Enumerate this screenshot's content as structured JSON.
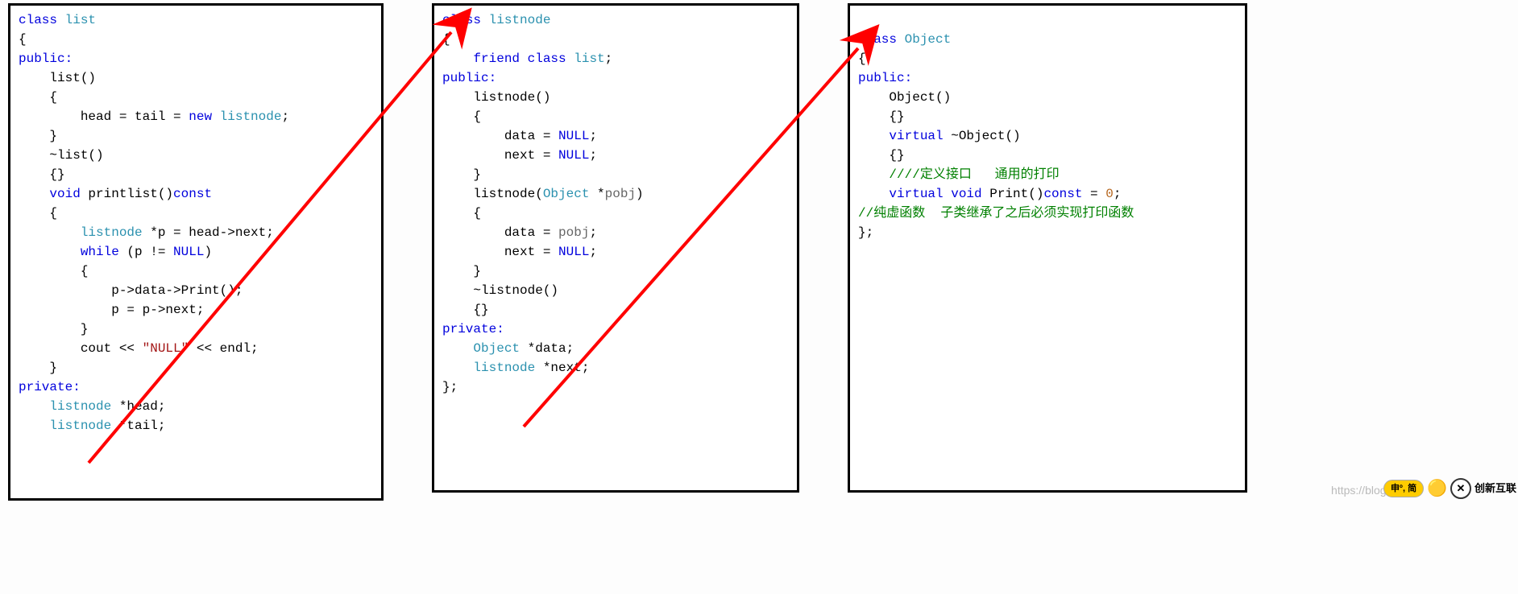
{
  "box1": {
    "l1": "class ",
    "l1t": "list",
    "l2": "{",
    "l3": "public:",
    "l4": "    list()",
    "l5": "    {",
    "l6a": "        head = tail = ",
    "l6b": "new ",
    "l6c": "listnode",
    "l6d": ";",
    "l7": "    }",
    "l8": "    ~list()",
    "l9": "    {}",
    "l10a": "    ",
    "l10b": "void",
    "l10c": " printlist()",
    "l10d": "const",
    "l11": "    {",
    "l12a": "        ",
    "l12b": "listnode",
    "l12c": " *p = head->next;",
    "l13a": "        ",
    "l13b": "while",
    "l13c": " (p != ",
    "l13d": "NULL",
    "l13e": ")",
    "l14": "        {",
    "l15": "            p->data->Print();",
    "l16": "            p = p->next;",
    "l17": "        }",
    "l18a": "        cout << ",
    "l18b": "\"NULL\"",
    "l18c": " << endl;",
    "l19": "    }",
    "l20": "private:",
    "l21a": "    ",
    "l21b": "listnode",
    "l21c": " *head;",
    "l22a": "    ",
    "l22b": "listnode",
    "l22c": " *tail;"
  },
  "box2": {
    "l1a": "class ",
    "l1b": "listnode",
    "l2": "{",
    "l3a": "    ",
    "l3b": "friend class ",
    "l3c": "list",
    "l3d": ";",
    "l4": "public:",
    "l5": "    listnode()",
    "l6": "    {",
    "l7a": "        data = ",
    "l7b": "NULL",
    "l7c": ";",
    "l8a": "        next = ",
    "l8b": "NULL",
    "l8c": ";",
    "l9": "    }",
    "l10a": "    listnode(",
    "l10b": "Object",
    "l10c": " *",
    "l10d": "pobj",
    "l10e": ")",
    "l11": "    {",
    "l12a": "        data = ",
    "l12b": "pobj",
    "l12c": ";",
    "l13a": "        next = ",
    "l13b": "NULL",
    "l13c": ";",
    "l14": "    }",
    "l15": "    ~listnode()",
    "l16": "    {}",
    "l17": "private:",
    "l18a": "    ",
    "l18b": "Object",
    "l18c": " *data;",
    "l19a": "    ",
    "l19b": "listnode",
    "l19c": " *next;",
    "l20": "};"
  },
  "box3": {
    "l1a": "class ",
    "l1b": "Object",
    "l2": "{",
    "l3": "public:",
    "l4": "    Object()",
    "l5": "    {}",
    "l6a": "    ",
    "l6b": "virtual",
    "l6c": " ~Object()",
    "l7": "    {}",
    "l8": "    ////定义接口   通用的打印",
    "l9a": "    ",
    "l9b": "virtual void",
    "l9c": " Print()",
    "l9d": "const",
    "l9e": " = ",
    "l9f": "0",
    "l9g": ";",
    "l10": "//纯虚函数  子类继承了之后必须实现打印函数",
    "l11": "};"
  },
  "watermark": "https://blog.csdn",
  "badge_bubble": "申º, 简",
  "badge_text": "创新互联"
}
